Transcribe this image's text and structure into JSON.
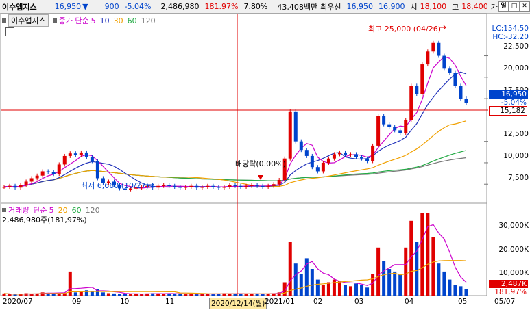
{
  "topbar": {
    "name": "이수앱지스",
    "price": "16,950",
    "down_arrow": "▼",
    "change": "900",
    "pct": "-5.04%",
    "volume": "2,486,980",
    "vol_ratio": "181.97%",
    "turnover": "7.80%",
    "amount": "43,408백만",
    "quote_label": "최우선",
    "ask": "16,950",
    "bid": "16,900",
    "open_label": "시",
    "open": "18,100",
    "high_label": "고",
    "high": "18,400",
    "cut": "가",
    "btn1": "일",
    "btn2": "□",
    "btn3": "✕"
  },
  "price_legend": {
    "name": "이수앱지스",
    "label": "종가 단순",
    "ma5": "5",
    "ma10": "10",
    "ma30": "30",
    "ma60": "60",
    "ma120": "120"
  },
  "right_info": {
    "lc": "LC:154.50",
    "hc": "HC:-32.20"
  },
  "y_ticks": [
    "22,500",
    "20,000",
    "17,500",
    "12,500",
    "10,000",
    "7,500"
  ],
  "price_box": {
    "price": "16,950",
    "pct": "-5.04%",
    "cross": "15,182"
  },
  "annotations": {
    "high": "최고 25,000 (04/26)",
    "low": "최저 6,660 (10/27)",
    "dividend": "배당락(0.00%)"
  },
  "volume_legend": {
    "label": "거래량",
    "ma_label": "단순",
    "ma5": "5",
    "ma20": "20",
    "ma60": "60",
    "ma120": "120",
    "info": "2,486,980주(181,97%)"
  },
  "vol_ticks": [
    "30,000K",
    "20,000K",
    "10,000K"
  ],
  "vol_box": {
    "value": "2,487K",
    "pct": "181.97%"
  },
  "x_axis": [
    "2020/07",
    "09",
    "10",
    "11",
    "2020/12/14(월)",
    "2021/01",
    "02",
    "03",
    "04",
    "05",
    "05/07"
  ],
  "colors": {
    "up": "#e00000",
    "down": "#0044cc",
    "ma5": "#cc00cc",
    "ma10": "#2233bb",
    "ma30": "#f0a000",
    "ma60": "#22aa44",
    "ma120": "#777777",
    "crosshair": "#e00000"
  },
  "chart_data": {
    "type": "candlestick",
    "xlabels": [
      "2020/07",
      "09",
      "10",
      "11",
      "2021/01",
      "02",
      "03",
      "04",
      "05",
      "05/07"
    ],
    "ylim": [
      6000,
      25500
    ],
    "close": [
      7200,
      7300,
      7100,
      7400,
      7800,
      8200,
      8500,
      9000,
      8900,
      8700,
      9800,
      10800,
      11100,
      10900,
      11200,
      10700,
      10200,
      8200,
      7600,
      7800,
      7400,
      7000,
      6900,
      7000,
      7100,
      7200,
      7300,
      7100,
      7300,
      7400,
      7300,
      7200,
      7100,
      7200,
      7300,
      7100,
      7200,
      7300,
      7200,
      7100,
      7200,
      7400,
      7300,
      7200,
      7300,
      7400,
      7300,
      7200,
      7300,
      7500,
      8000,
      10500,
      16000,
      12500,
      11500,
      10800,
      9500,
      9000,
      10000,
      10500,
      11000,
      11200,
      10900,
      11000,
      10700,
      10500,
      10200,
      12000,
      15500,
      14500,
      14200,
      13800,
      13500,
      15000,
      19000,
      18000,
      21500,
      23000,
      24000,
      22500,
      21000,
      20500,
      19000,
      17500,
      16950
    ],
    "volume_k": [
      800,
      500,
      400,
      600,
      900,
      700,
      800,
      1200,
      1000,
      900,
      1100,
      1000,
      9000,
      1200,
      1500,
      2000,
      1800,
      2500,
      1200,
      900,
      800,
      700,
      600,
      500,
      700,
      600,
      800,
      900,
      700,
      600,
      800,
      700,
      600,
      500,
      700,
      600,
      800,
      600,
      500,
      700,
      900,
      800,
      700,
      600,
      500,
      700,
      800,
      600,
      700,
      900,
      1200,
      5000,
      20000,
      12000,
      8000,
      14000,
      10000,
      6000,
      4000,
      5000,
      6000,
      5500,
      4000,
      3500,
      4500,
      4000,
      3000,
      8000,
      18000,
      13000,
      10000,
      9000,
      8000,
      18000,
      28000,
      20000,
      31000,
      32000,
      22000,
      12000,
      9000,
      6000,
      4000,
      3500,
      2487
    ]
  }
}
